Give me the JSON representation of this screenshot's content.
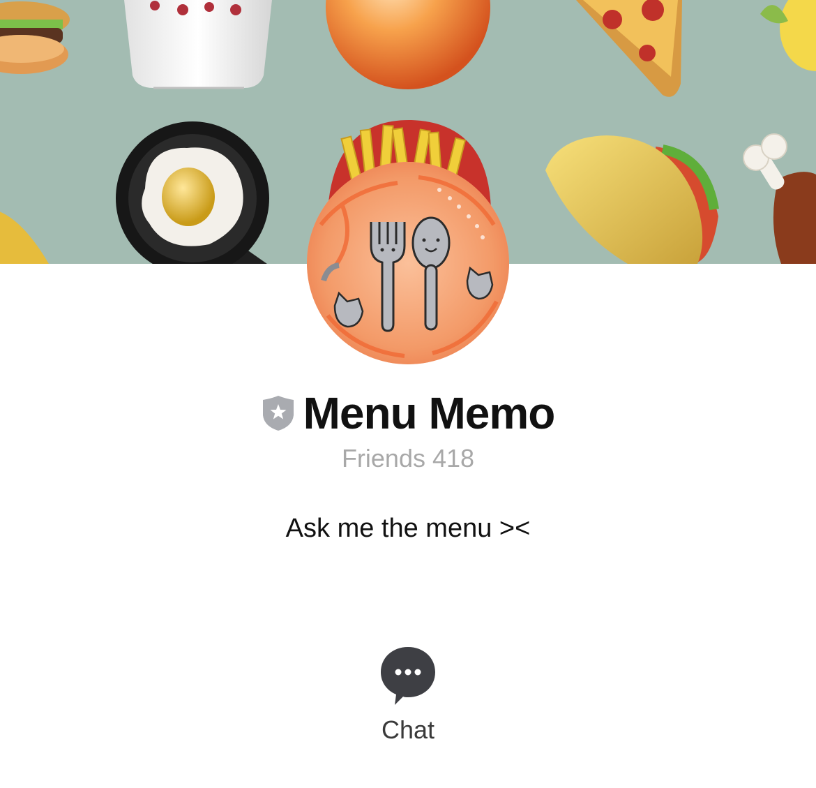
{
  "profile": {
    "name": "Menu Memo",
    "friends_label": "Friends",
    "friends_count": "418",
    "status_message": "Ask me the menu ><"
  },
  "badge": {
    "icon": "shield-star-icon",
    "color": "#a9abb0"
  },
  "cover": {
    "background_color": "#a3bcb2",
    "illustrations": [
      "burger",
      "drink-cup",
      "orange",
      "pizza-slice",
      "fried-egg-pan",
      "fries",
      "taco",
      "chicken-drumstick"
    ]
  },
  "avatar": {
    "illustrations": [
      "fork",
      "spoon",
      "cat"
    ]
  },
  "actions": {
    "chat_label": "Chat",
    "chat_icon": "chat-bubble-icon"
  }
}
